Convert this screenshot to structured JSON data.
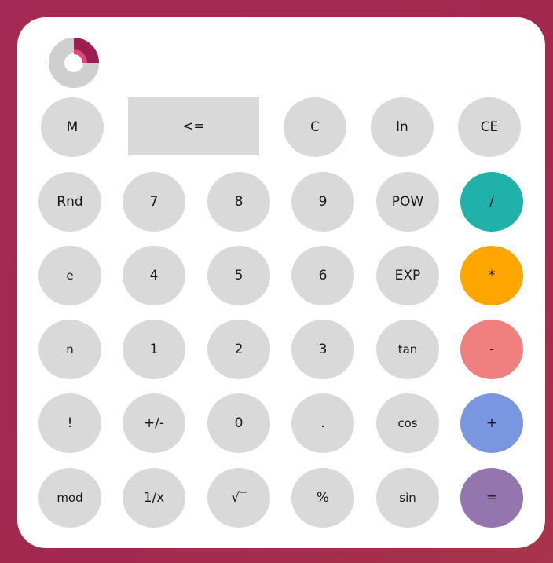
{
  "logo": {
    "icon": "donut-chart-logo-icon",
    "ring_color": "#cfcfcf",
    "accent_colors": [
      "#9b1d52",
      "#e8427a"
    ]
  },
  "colors": {
    "key_default": "#d9d9d9",
    "divide": "#20b2aa",
    "multiply": "#ffa500",
    "subtract": "#f08080",
    "add": "#7b96e0",
    "equals": "#9575ae"
  },
  "keys": {
    "memory": "M",
    "backspace": "<=",
    "clear": "C",
    "ln": "ln",
    "clear_entry": "CE",
    "rnd": "Rnd",
    "seven": "7",
    "eight": "8",
    "nine": "9",
    "pow": "POW",
    "divide": "/",
    "e": "e",
    "four": "4",
    "five": "5",
    "six": "6",
    "exp": "EXP",
    "multiply": "*",
    "n": "n",
    "one": "1",
    "two": "2",
    "three": "3",
    "tan": "tan",
    "subtract": "-",
    "factorial": "!",
    "plus_minus": "+/-",
    "zero": "0",
    "decimal": ".",
    "cos": "cos",
    "add": "+",
    "mod": "mod",
    "reciprocal": "1/x",
    "sqrt": "√‾",
    "percent": "%",
    "sin": "sin",
    "equals": "="
  }
}
